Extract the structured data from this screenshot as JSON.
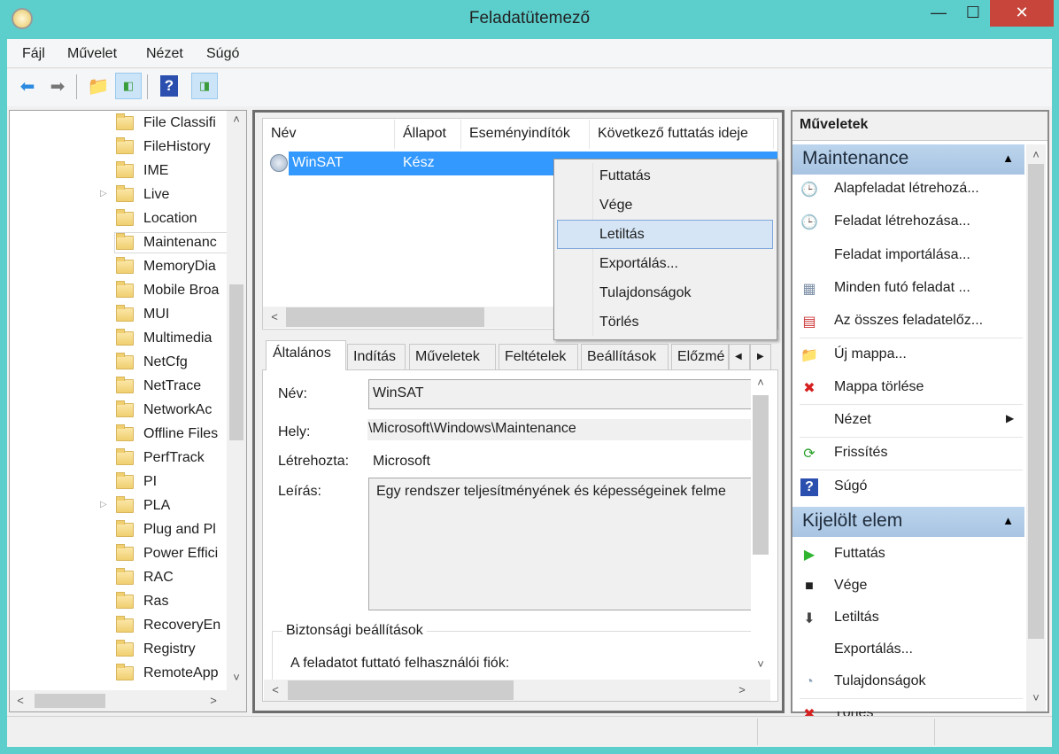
{
  "window": {
    "title": "Feladatütemező",
    "minimize": "—",
    "maximize": "☐",
    "close": "✕"
  },
  "menu": [
    "Fájl",
    "Művelet",
    "Nézet",
    "Súgó"
  ],
  "toolbar": [
    "back-icon",
    "forward-icon",
    "up-folder-icon",
    "show-hide-console-tree-icon",
    "help-icon",
    "show-hide-action-pane-icon"
  ],
  "tree": {
    "items": [
      {
        "label": "File Classifi",
        "expandable": false
      },
      {
        "label": "FileHistory",
        "expandable": false
      },
      {
        "label": "IME",
        "expandable": false
      },
      {
        "label": "Live",
        "expandable": true
      },
      {
        "label": "Location",
        "expandable": false
      },
      {
        "label": "Maintenanc",
        "expandable": false,
        "selected": true
      },
      {
        "label": "MemoryDia",
        "expandable": false
      },
      {
        "label": "Mobile Broa",
        "expandable": false
      },
      {
        "label": "MUI",
        "expandable": false
      },
      {
        "label": "Multimedia",
        "expandable": false
      },
      {
        "label": "NetCfg",
        "expandable": false
      },
      {
        "label": "NetTrace",
        "expandable": false
      },
      {
        "label": "NetworkAc",
        "expandable": false
      },
      {
        "label": "Offline Files",
        "expandable": false
      },
      {
        "label": "PerfTrack",
        "expandable": false
      },
      {
        "label": "PI",
        "expandable": false
      },
      {
        "label": "PLA",
        "expandable": true
      },
      {
        "label": "Plug and Pl",
        "expandable": false
      },
      {
        "label": "Power Effici",
        "expandable": false
      },
      {
        "label": "RAC",
        "expandable": false
      },
      {
        "label": "Ras",
        "expandable": false
      },
      {
        "label": "RecoveryEn",
        "expandable": false
      },
      {
        "label": "Registry",
        "expandable": false
      },
      {
        "label": "RemoteApp",
        "expandable": false
      }
    ]
  },
  "task_list": {
    "columns": [
      "Név",
      "Állapot",
      "Eseményindítók",
      "Következő futtatás ideje"
    ],
    "rows": [
      {
        "name": "WinSAT",
        "status": "Kész"
      }
    ]
  },
  "context_menu": {
    "items": [
      "Futtatás",
      "Vége",
      "Letiltás",
      "Exportálás...",
      "Tulajdonságok",
      "Törlés"
    ],
    "highlighted": "Letiltás"
  },
  "tabs": [
    "Általános",
    "Indítás",
    "Műveletek",
    "Feltételek",
    "Beállítások",
    "Előzmé"
  ],
  "general": {
    "name_label": "Név:",
    "name_value": "WinSAT",
    "location_label": "Hely:",
    "location_value": "\\Microsoft\\Windows\\Maintenance",
    "author_label": "Létrehozta:",
    "author_value": "Microsoft",
    "description_label": "Leírás:",
    "description_value": "Egy rendszer teljesítményének és képességeinek felme",
    "security_group": "Biztonsági beállítások",
    "account_label": "A feladatot futtató felhasználói fiók:"
  },
  "actions": {
    "title": "Műveletek",
    "section1": {
      "title": "Maintenance",
      "items": [
        {
          "label": "Alapfeladat létrehozá...",
          "icon": "create-basic-task-icon"
        },
        {
          "label": "Feladat létrehozása...",
          "icon": "create-task-icon"
        },
        {
          "label": "Feladat importálása...",
          "icon": ""
        },
        {
          "label": "Minden futó feladat ...",
          "icon": "running-tasks-icon"
        },
        {
          "label": "Az összes feladatelőz...",
          "icon": "task-history-icon"
        },
        {
          "label": "Új mappa...",
          "icon": "new-folder-icon"
        },
        {
          "label": "Mappa törlése",
          "icon": "delete-folder-icon"
        },
        {
          "label": "Nézet",
          "icon": "",
          "submenu": true
        },
        {
          "label": "Frissítés",
          "icon": "refresh-icon"
        },
        {
          "label": "Súgó",
          "icon": "help-icon"
        }
      ]
    },
    "section2": {
      "title": "Kijelölt elem",
      "items": [
        {
          "label": "Futtatás",
          "icon": "run-icon"
        },
        {
          "label": "Vége",
          "icon": "stop-icon"
        },
        {
          "label": "Letiltás",
          "icon": "disable-icon"
        },
        {
          "label": "Exportálás...",
          "icon": ""
        },
        {
          "label": "Tulajdonságok",
          "icon": "properties-icon"
        },
        {
          "label": "Törlés",
          "icon": "delete-icon"
        }
      ]
    }
  },
  "colors": {
    "accent": "#3399ff",
    "window_frame": "#5ccfcd",
    "section_header": "#b0cbe7",
    "close": "#c7453b"
  }
}
